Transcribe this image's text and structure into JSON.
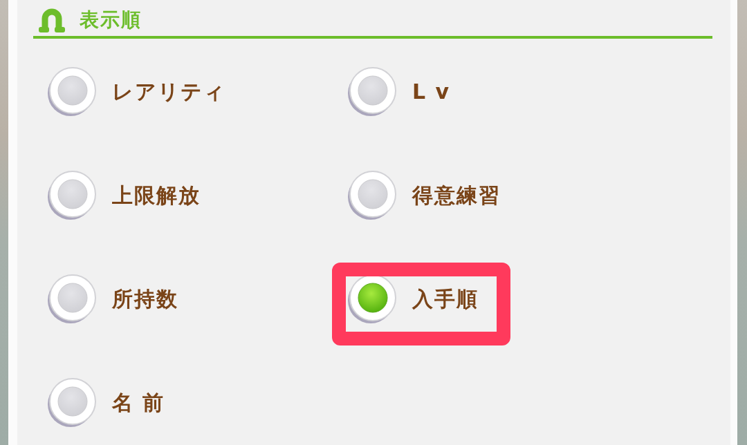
{
  "section": {
    "title": "表示順"
  },
  "options": [
    {
      "label": "レアリティ",
      "selected": false,
      "highlighted": false
    },
    {
      "label": "L v",
      "selected": false,
      "highlighted": false
    },
    {
      "label": "上限解放",
      "selected": false,
      "highlighted": false
    },
    {
      "label": "得意練習",
      "selected": false,
      "highlighted": false
    },
    {
      "label": "所持数",
      "selected": false,
      "highlighted": false
    },
    {
      "label": "入手順",
      "selected": true,
      "highlighted": true
    },
    {
      "label": "名 前",
      "selected": false,
      "highlighted": false
    }
  ]
}
